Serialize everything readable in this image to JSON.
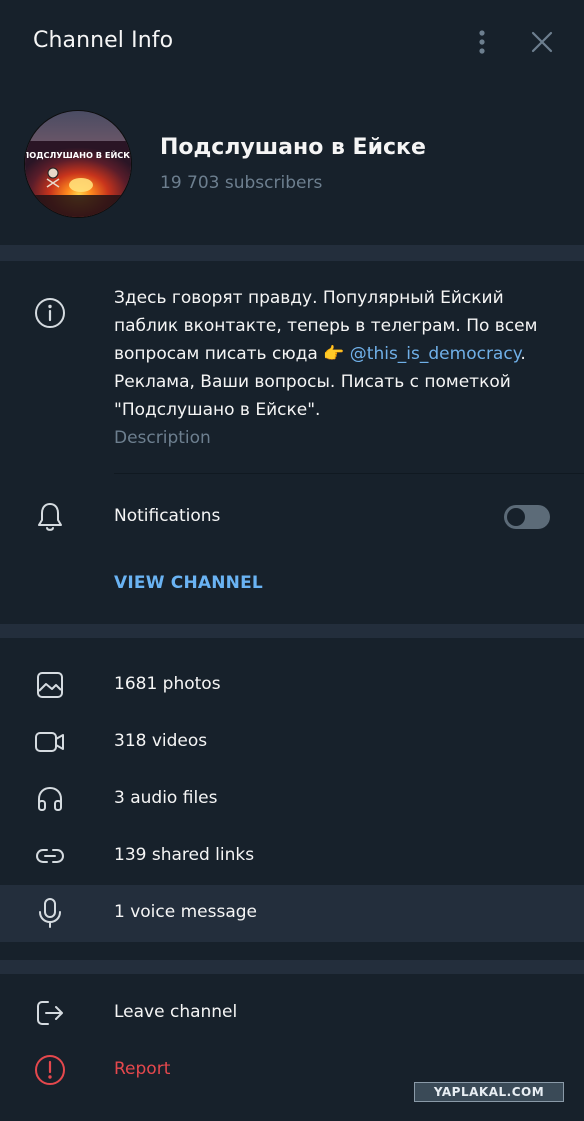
{
  "header": {
    "title": "Channel Info"
  },
  "channel": {
    "name": "Подслушано в Ейске",
    "subscribers": "19 703 subscribers",
    "avatar_text": "ПОДСЛУШАНО В ЕЙСКЕ"
  },
  "info": {
    "description_part1": "Здесь говорят правду. Популярный Ейский паблик вконтакте, теперь в телеграм. По всем вопросам писать сюда 👉 ",
    "link": "@this_is_democracy",
    "description_part2": ". Реклама, Ваши вопросы. Писать с пометкой \"Подслушано в Ейске\".",
    "description_label": "Description",
    "notifications_label": "Notifications",
    "notifications_on": false,
    "view_channel": "VIEW CHANNEL"
  },
  "media": [
    {
      "icon": "photo-icon",
      "label": "1681 photos"
    },
    {
      "icon": "video-icon",
      "label": "318 videos"
    },
    {
      "icon": "headphones-icon",
      "label": "3 audio files"
    },
    {
      "icon": "link-icon",
      "label": "139 shared links"
    },
    {
      "icon": "microphone-icon",
      "label": "1 voice message"
    }
  ],
  "actions": {
    "leave": "Leave channel",
    "report": "Report"
  },
  "watermark": "YAPLAKAL.COM",
  "colors": {
    "background": "#17212b",
    "separator": "#232e3c",
    "accent": "#6ab3f3",
    "link": "#70b0e8",
    "danger": "#e5484d",
    "muted": "#6d7f8f"
  }
}
